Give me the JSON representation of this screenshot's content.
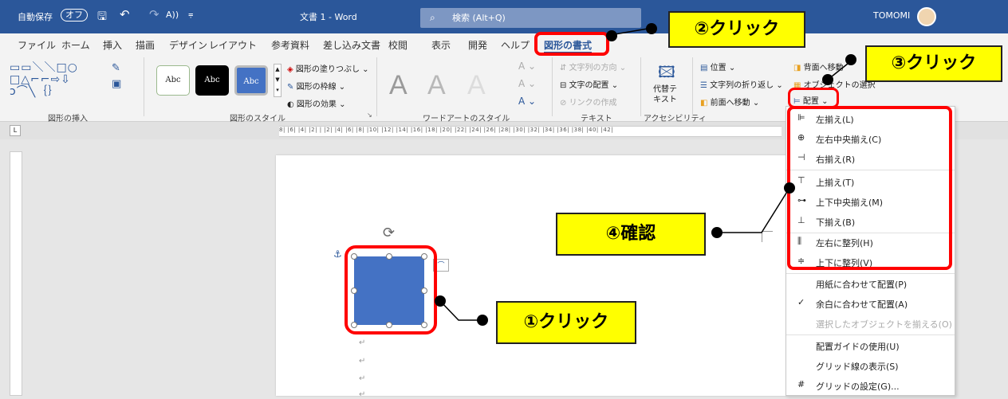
{
  "titlebar": {
    "autosave_label": "自動保存",
    "autosave_state": "オフ",
    "doc_title": "文書 1 - Word",
    "search_placeholder": "検索 (Alt+Q)",
    "user_name": "TOMOMI"
  },
  "tabs": [
    "ファイル",
    "ホーム",
    "挿入",
    "描画",
    "デザイン",
    "レイアウト",
    "参考資料",
    "差し込み文書",
    "校閲",
    "表示",
    "開発",
    "ヘルプ",
    "図形の書式"
  ],
  "ribbon": {
    "insert_shapes_label": "図形の挿入",
    "shape_styles_label": "図形のスタイル",
    "style_sample": "Abc",
    "fill": "図形の塗りつぶし",
    "outline": "図形の枠線",
    "effects": "図形の効果",
    "wordart_label": "ワードアートのスタイル",
    "wordart_letter": "A",
    "text_direction": "文字列の方向",
    "text_align": "文字の配置",
    "create_link": "リンクの作成",
    "text_group": "テキスト",
    "alt_text_line1": "代替テ",
    "alt_text_line2": "キスト",
    "accessibility": "アクセシビリティ",
    "position": "位置",
    "wrap_text": "文字列の折り返し",
    "bring_forward": "前面へ移動",
    "send_backward": "背面へ移動",
    "selection_pane": "オブジェクトの選択",
    "align_button": "配置"
  },
  "ruler_text": "8| |6| |4| |2| |  |2| |4| |6| |8| |10| |12| |14| |16| |18| |20| |22| |24| |26| |28| |30| |32| |34| |36| |38| |40| |42|",
  "dropdown": {
    "items": [
      {
        "label": "左揃え(L)",
        "icon": "align-left-icon"
      },
      {
        "label": "左右中央揃え(C)",
        "icon": "align-center-icon"
      },
      {
        "label": "右揃え(R)",
        "icon": "align-right-icon"
      },
      {
        "label": "上揃え(T)",
        "icon": "align-top-icon"
      },
      {
        "label": "上下中央揃え(M)",
        "icon": "align-middle-icon"
      },
      {
        "label": "下揃え(B)",
        "icon": "align-bottom-icon"
      },
      {
        "label": "左右に整列(H)",
        "icon": "distribute-horizontal-icon"
      },
      {
        "label": "上下に整列(V)",
        "icon": "distribute-vertical-icon"
      },
      {
        "label": "用紙に合わせて配置(P)",
        "icon": ""
      },
      {
        "label": "余白に合わせて配置(A)",
        "icon": "checkmark-icon"
      },
      {
        "label": "選択したオブジェクトを揃える(O)",
        "icon": "",
        "disabled": true
      },
      {
        "label": "配置ガイドの使用(U)",
        "icon": ""
      },
      {
        "label": "グリッド線の表示(S)",
        "icon": ""
      },
      {
        "label": "グリッドの設定(G)...",
        "icon": "grid-icon"
      }
    ]
  },
  "callouts": {
    "c1": "①クリック",
    "c2": "②クリック",
    "c3": "③クリック",
    "c4": "④確認"
  },
  "colors": {
    "title_bar": "#2b579a",
    "accent_red": "#ff0000",
    "callout_yellow": "#ffff00",
    "shape_fill": "#4472c4"
  }
}
